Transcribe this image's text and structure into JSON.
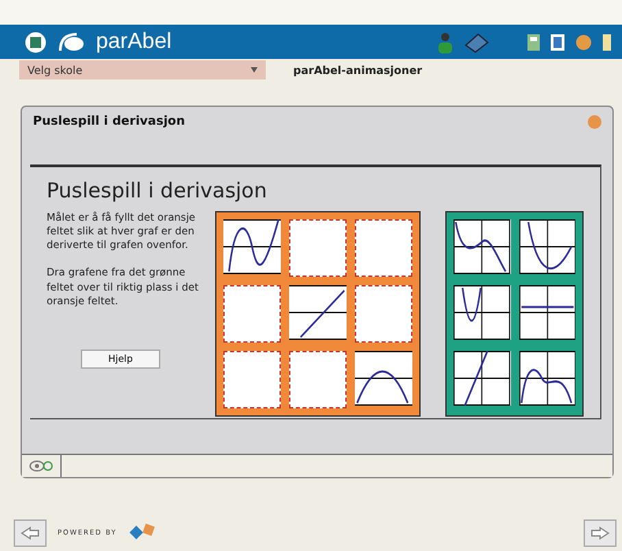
{
  "header": {
    "brand": "parAbel"
  },
  "breadcrumb": {
    "school": "Velg skole",
    "section": "parAbel-animasjoner"
  },
  "panel": {
    "title": "Puslespill i derivasjon",
    "heading": "Puslespill i derivasjon",
    "paragraphs": [
      "Målet er å få fyllt det oransje feltet slik at hver graf er den deriverte til grafen ovenfor.",
      "Dra grafene fra det grønne feltet over til riktig plass i det oransje feltet."
    ],
    "help_button": "Hjelp"
  },
  "target_grid": [
    {
      "kind": "cubic"
    },
    {
      "kind": "slot"
    },
    {
      "kind": "slot"
    },
    {
      "kind": "slot"
    },
    {
      "kind": "line"
    },
    {
      "kind": "slot"
    },
    {
      "kind": "slot"
    },
    {
      "kind": "slot"
    },
    {
      "kind": "arch"
    }
  ],
  "source_grid": [
    {
      "kind": "wave"
    },
    {
      "kind": "valley"
    },
    {
      "kind": "parabola"
    },
    {
      "kind": "flat"
    },
    {
      "kind": "steep"
    },
    {
      "kind": "bumps"
    }
  ],
  "footer": {
    "powered": "POWERED BY"
  }
}
